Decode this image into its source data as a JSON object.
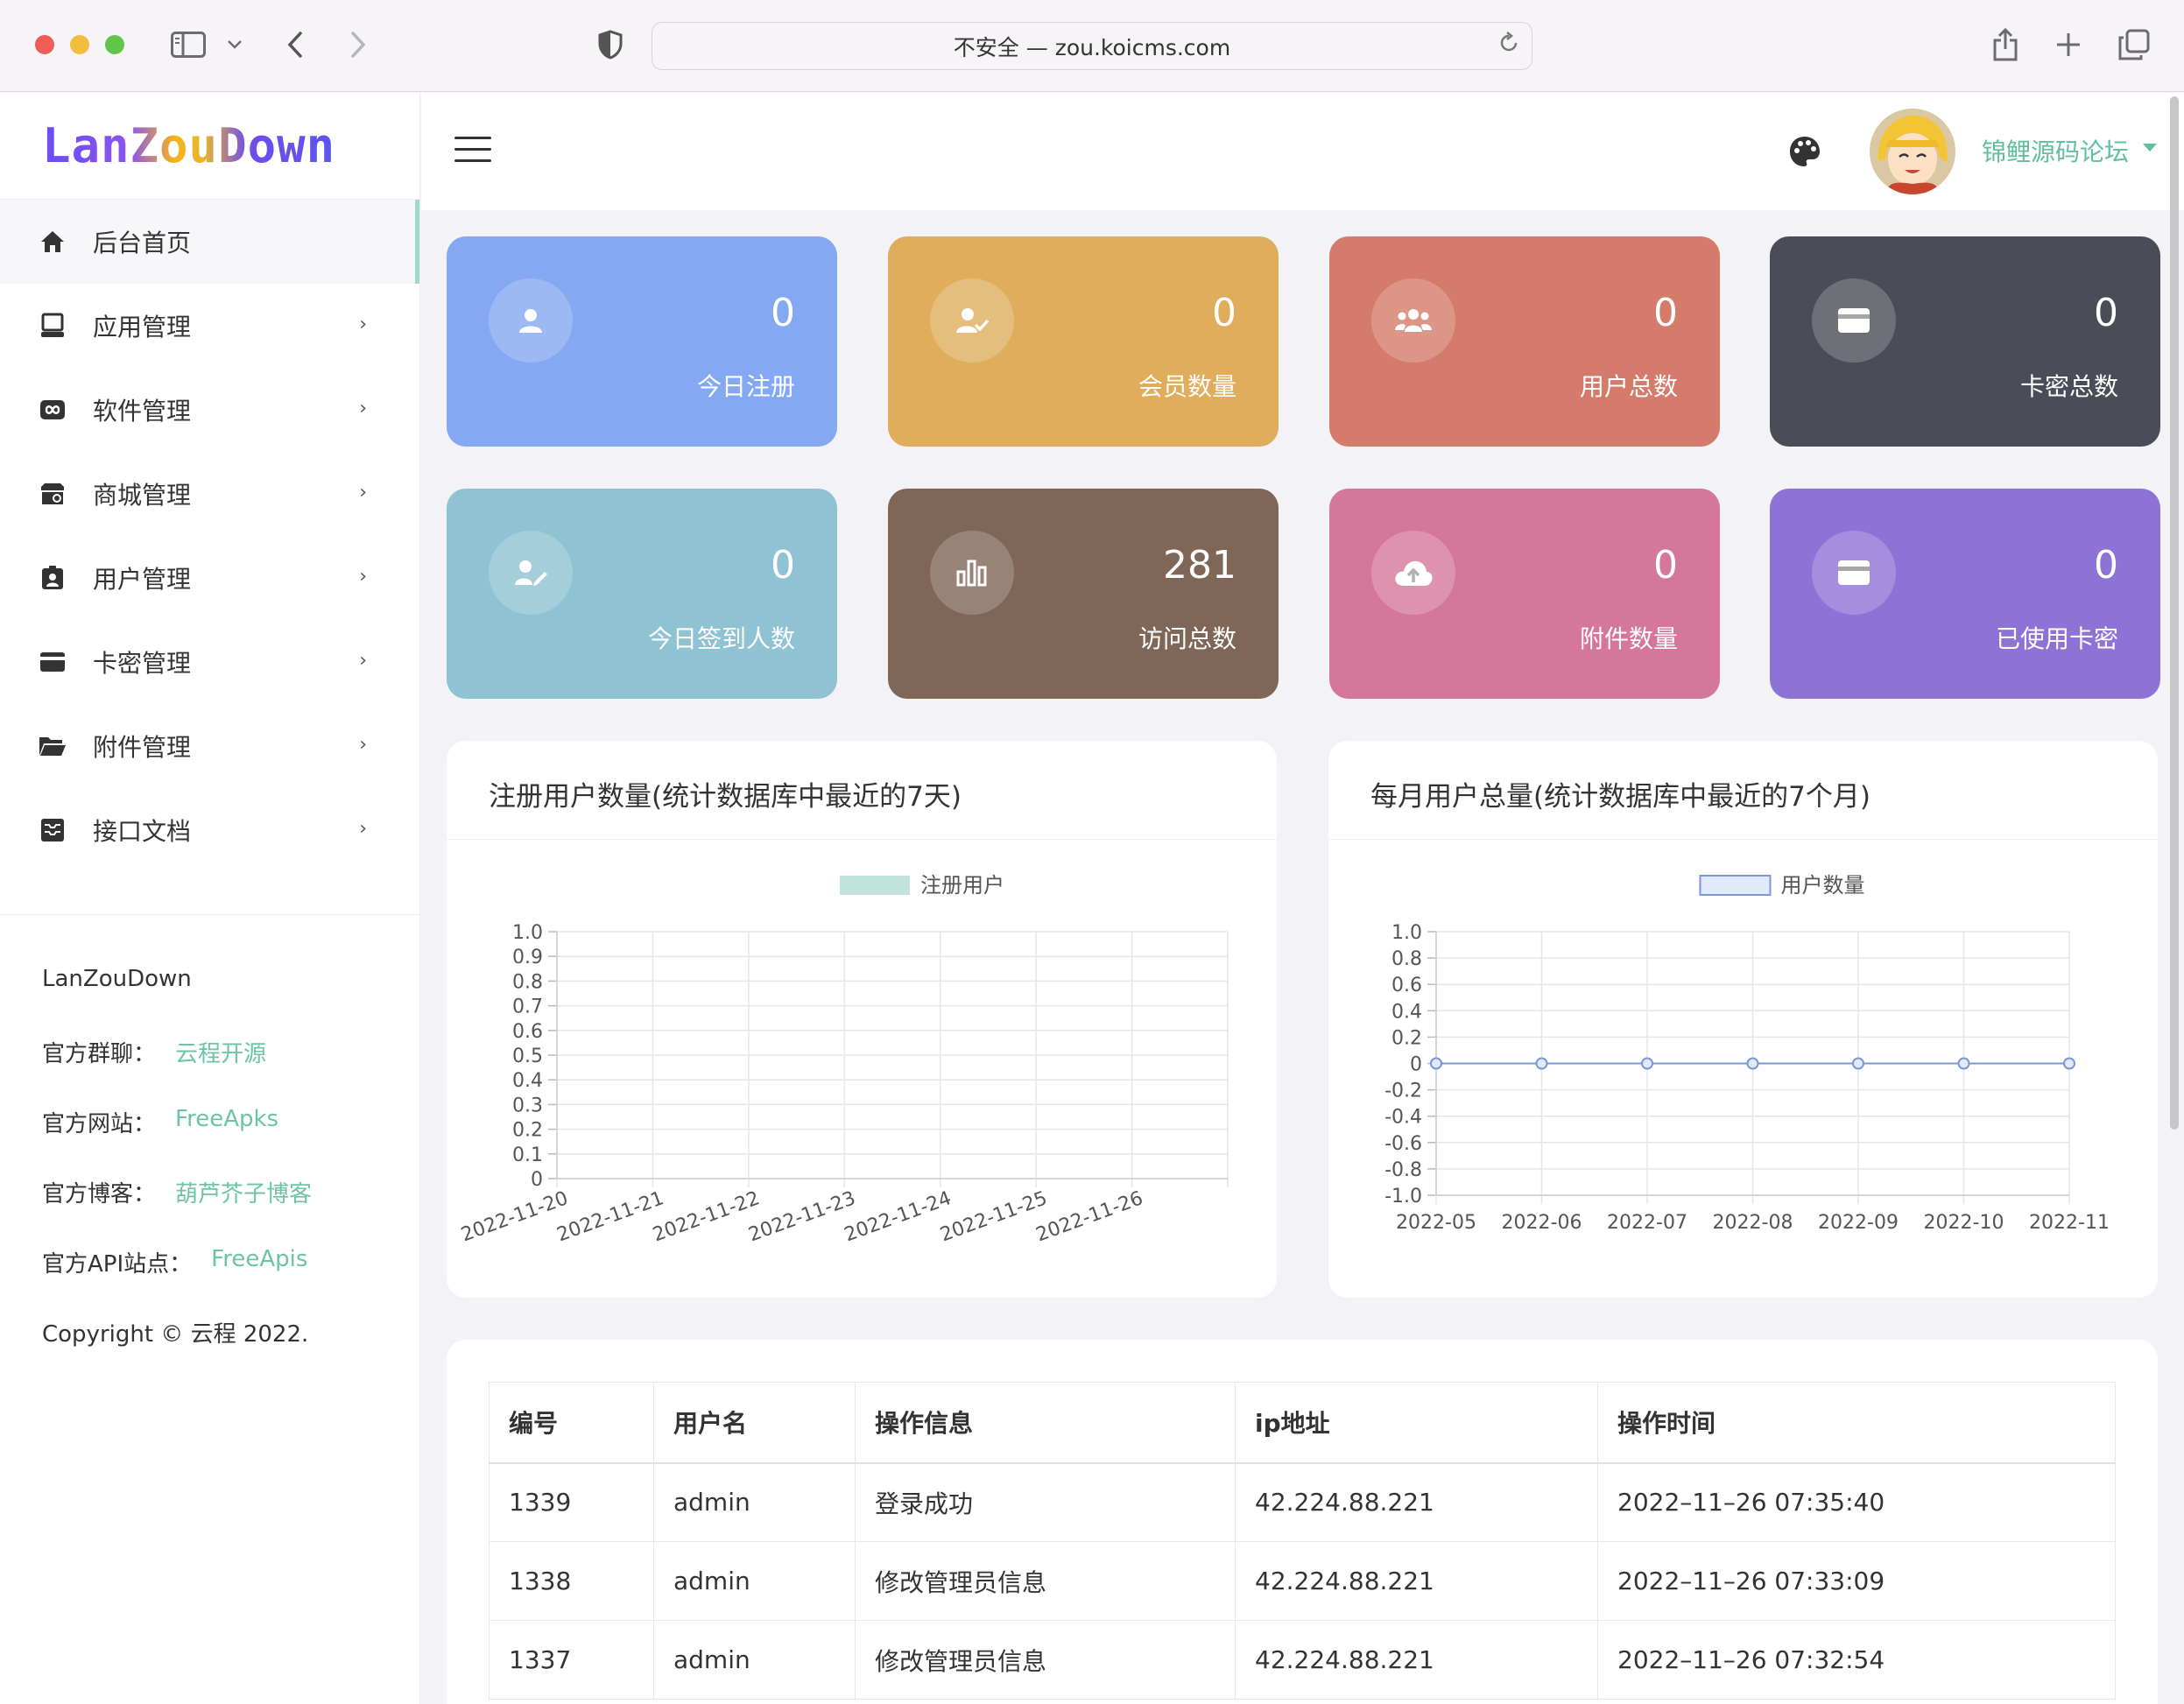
{
  "browser": {
    "url_text": "不安全 — zou.koicms.com",
    "icons": [
      "sidebar-icon",
      "chevron-down-icon",
      "back-icon",
      "forward-icon",
      "shield-icon",
      "reload-icon",
      "share-icon",
      "new-tab-icon",
      "tabs-icon"
    ]
  },
  "sidebar": {
    "logo": "LanZouDown",
    "items": [
      {
        "label": "后台首页",
        "icon": "home-icon",
        "active": true
      },
      {
        "label": "应用管理",
        "icon": "app-icon"
      },
      {
        "label": "软件管理",
        "icon": "infinity-icon"
      },
      {
        "label": "商城管理",
        "icon": "store-icon"
      },
      {
        "label": "用户管理",
        "icon": "user-badge-icon"
      },
      {
        "label": "卡密管理",
        "icon": "card-icon"
      },
      {
        "label": "附件管理",
        "icon": "folder-icon"
      },
      {
        "label": "接口文档",
        "icon": "inbox-icon"
      }
    ],
    "info": {
      "brand": "LanZouDown",
      "group_label": "官方群聊：",
      "group_link": "云程开源",
      "site_label": "官方网站：",
      "site_link": "FreeApks",
      "blog_label": "官方博客：",
      "blog_link": "葫芦芥子博客",
      "api_label": "官方API站点：",
      "api_link": "FreeApis",
      "copyright": "Copyright © 云程 2022."
    }
  },
  "topbar": {
    "username": "锦鲤源码论坛"
  },
  "cards": [
    {
      "value": "0",
      "label": "今日注册",
      "color": "#84a8f1",
      "icon": "user-icon"
    },
    {
      "value": "0",
      "label": "会员数量",
      "color": "#dfad5c",
      "icon": "user-check-icon"
    },
    {
      "value": "0",
      "label": "用户总数",
      "color": "#d57b6b",
      "icon": "users-icon"
    },
    {
      "value": "0",
      "label": "卡密总数",
      "color": "#4a4d57",
      "icon": "card-icon"
    },
    {
      "value": "0",
      "label": "今日签到人数",
      "color": "#8fc2d3",
      "icon": "user-edit-icon"
    },
    {
      "value": "281",
      "label": "访问总数",
      "color": "#7f6656",
      "icon": "bar-chart-icon"
    },
    {
      "value": "0",
      "label": "附件数量",
      "color": "#d5779a",
      "icon": "cloud-upload-icon"
    },
    {
      "value": "0",
      "label": "已使用卡密",
      "color": "#8e72d5",
      "icon": "card-icon"
    }
  ],
  "chart_data": [
    {
      "type": "bar",
      "title": "注册用户数量(统计数据库中最近的7天)",
      "categories": [
        "2022-11-20",
        "2022-11-21",
        "2022-11-22",
        "2022-11-23",
        "2022-11-24",
        "2022-11-25",
        "2022-11-26"
      ],
      "series": [
        {
          "name": "注册用户",
          "values": [
            0,
            0,
            0,
            0,
            0,
            0,
            0
          ],
          "color": "#c1e3d9"
        }
      ],
      "yticks": [
        "1.0",
        "0.9",
        "0.8",
        "0.7",
        "0.6",
        "0.5",
        "0.4",
        "0.3",
        "0.2",
        "0.1",
        "0"
      ],
      "ylim": [
        0,
        1.0
      ],
      "grid": true,
      "legend": "top"
    },
    {
      "type": "line",
      "title": "每月用户总量(统计数据库中最近的7个月)",
      "categories": [
        "2022-05",
        "2022-06",
        "2022-07",
        "2022-08",
        "2022-09",
        "2022-10",
        "2022-11"
      ],
      "series": [
        {
          "name": "用户数量",
          "values": [
            0,
            0,
            0,
            0,
            0,
            0,
            0
          ],
          "color": "#7b97d4"
        }
      ],
      "yticks": [
        "1.0",
        "0.8",
        "0.6",
        "0.4",
        "0.2",
        "0",
        "-0.2",
        "-0.4",
        "-0.6",
        "-0.8",
        "-1.0"
      ],
      "ylim": [
        -1.0,
        1.0
      ],
      "grid": true,
      "legend": "top"
    }
  ],
  "table": {
    "headers": [
      "编号",
      "用户名",
      "操作信息",
      "ip地址",
      "操作时间"
    ],
    "rows": [
      [
        "1339",
        "admin",
        "登录成功",
        "42.224.88.221",
        "2022–11–26 07:35:40"
      ],
      [
        "1338",
        "admin",
        "修改管理员信息",
        "42.224.88.221",
        "2022–11–26 07:33:09"
      ],
      [
        "1337",
        "admin",
        "修改管理员信息",
        "42.224.88.221",
        "2022–11–26 07:32:54"
      ]
    ]
  }
}
